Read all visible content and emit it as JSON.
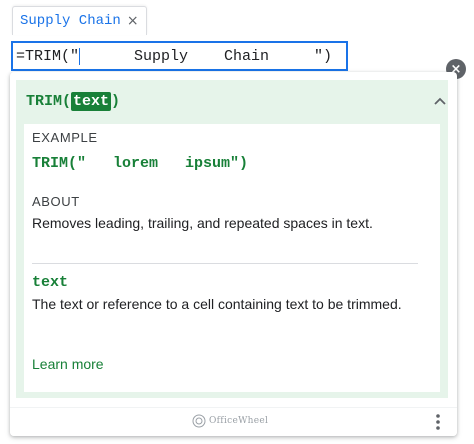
{
  "chip": {
    "label": "Supply Chain",
    "close_glyph": "×"
  },
  "formula": {
    "before_caret": "=TRIM(\"",
    "after_caret": "      Supply    Chain     \")"
  },
  "dismiss_glyph": "×",
  "help": {
    "function_prefix": "TRIM(",
    "function_arg": "text",
    "function_suffix": ")",
    "example_label": "EXAMPLE",
    "example_code": "TRIM(\"   lorem   ipsum\")",
    "about_label": "ABOUT",
    "about_text": "Removes leading, trailing, and repeated spaces in text.",
    "param_name": "text",
    "param_desc": "The text or reference to a cell containing text to be trimmed.",
    "learn_more": "Learn more"
  },
  "footer": {
    "watermark": "OfficeWheel"
  },
  "icons": {
    "collapse": "chevron-up-icon",
    "more": "more-vert-icon",
    "dismiss": "close-circle-icon"
  },
  "colors": {
    "accent_blue": "#1a73e8",
    "function_green": "#188038",
    "header_green_bg": "#e6f4ea"
  }
}
